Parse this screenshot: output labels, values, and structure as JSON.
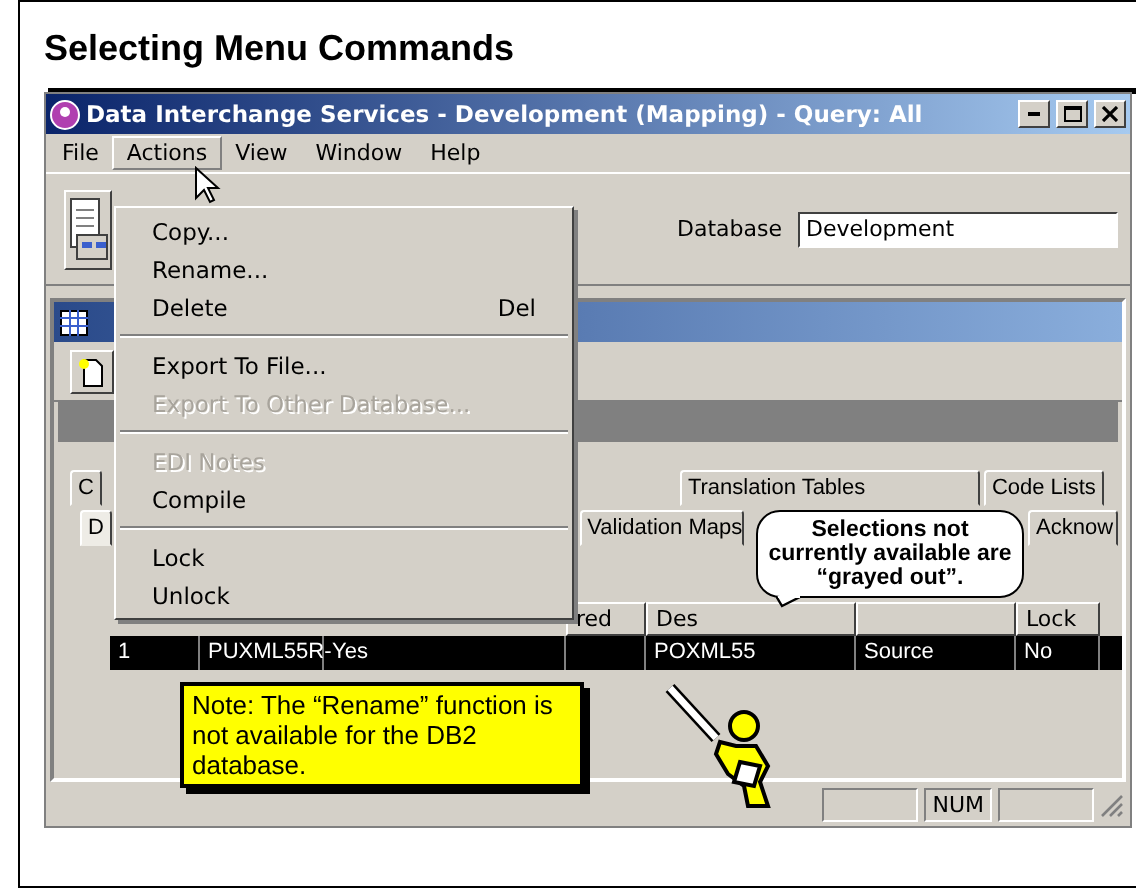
{
  "slide": {
    "title": "Selecting Menu Commands"
  },
  "window": {
    "title": "Data Interchange Services - Development (Mapping)  -  Query: All"
  },
  "menubar": [
    {
      "label": "File",
      "selected": false
    },
    {
      "label": "Actions",
      "selected": true
    },
    {
      "label": "View",
      "selected": false
    },
    {
      "label": "Window",
      "selected": false
    },
    {
      "label": "Help",
      "selected": false
    }
  ],
  "menu": [
    {
      "kind": "item",
      "label": "Copy...",
      "disabled": false
    },
    {
      "kind": "item",
      "label": "Rename...",
      "disabled": false
    },
    {
      "kind": "item",
      "label": "Delete",
      "shortcut": "Del",
      "disabled": false
    },
    {
      "kind": "separator"
    },
    {
      "kind": "item",
      "label": "Export To File...",
      "disabled": false
    },
    {
      "kind": "item",
      "label": "Export To Other Database...",
      "disabled": true
    },
    {
      "kind": "separator"
    },
    {
      "kind": "item",
      "label": "EDI Notes",
      "disabled": true
    },
    {
      "kind": "item",
      "label": "Compile",
      "disabled": false
    },
    {
      "kind": "separator"
    },
    {
      "kind": "item",
      "label": "Lock",
      "disabled": false
    },
    {
      "kind": "item",
      "label": "Unlock",
      "disabled": false
    }
  ],
  "toolbar": {
    "database_label": "Database",
    "database_value": "Development"
  },
  "tabs": [
    [
      {
        "label": "C",
        "selected": false
      },
      {
        "label": "Translation Tables",
        "selected": false
      },
      {
        "label": "Code Lists",
        "selected": false
      }
    ],
    [
      {
        "label": "D",
        "selected": true
      },
      {
        "label": "Validation Maps",
        "selected": false
      },
      {
        "label": "Acknow",
        "selected": false
      }
    ]
  ],
  "table": {
    "columns": [
      {},
      {},
      {},
      {
        "label": "red"
      },
      {
        "label": "Des"
      },
      {},
      {
        "label": "Lock"
      }
    ],
    "rows": [
      {
        "selected": true,
        "cells": [
          "1",
          "PUXML55R-",
          "Yes",
          null,
          "POXML55",
          "Source",
          "No"
        ]
      }
    ]
  },
  "status_bar": {
    "panels": [
      "NUM"
    ]
  },
  "note": {
    "text": "Note:  The “Rename” function is not available for the DB2 database."
  },
  "callout": {
    "text": "Selections not currently available are “grayed out”."
  }
}
